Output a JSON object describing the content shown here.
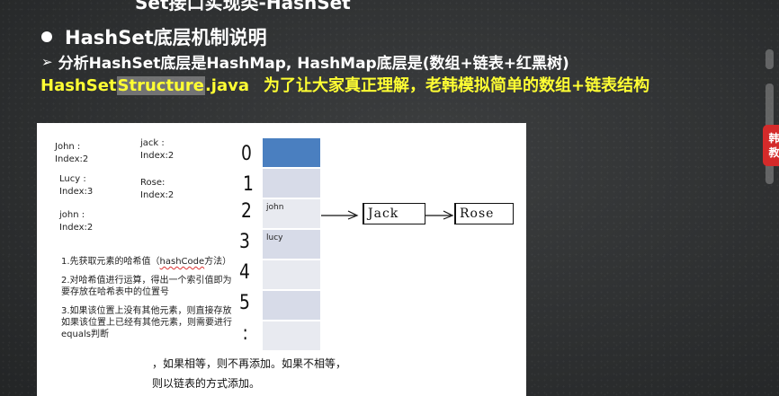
{
  "header": {
    "partial_title": "Set接口实现类-HashSet",
    "bullet_title": "HashSet底层机制说明",
    "sub_title": "分析HashSet底层是HashMap, HashMap底层是(数组+链表+红黑树)",
    "yellow_prefix": "HashSet",
    "yellow_highlight": "Structure",
    "yellow_suffix": ".java",
    "yellow_note": "为了让大家真正理解，老韩模拟简单的数组+链表结构"
  },
  "badge": {
    "line1": "韩",
    "line2": "教"
  },
  "panel": {
    "notes": [
      {
        "text": "John :\nIndex:2"
      },
      {
        "text": "jack :\nIndex:2"
      },
      {
        "text": "Lucy :\nIndex:3"
      },
      {
        "text": "Rose:\nIndex:2"
      },
      {
        "text": "john :\nIndex:2"
      }
    ],
    "steps": [
      {
        "pre": "1.先获取元素的哈希值（",
        "code": "hashCode",
        "post": "方法）"
      },
      {
        "pre": "2.对哈希值进行运算，得出一个索引值即为要存放在哈希表中的位置号",
        "code": "",
        "post": ""
      },
      {
        "pre": "3.如果该位置上没有其他元素，则直接存放\n如果该位置上已经有其他元素，则需要进行equals判断",
        "code": "",
        "post": ""
      }
    ],
    "tail1": "，如果相等，则不再添加。如果不相等，",
    "tail2": "则以链表的方式添加。",
    "indices": [
      "0",
      "1",
      "2",
      "3",
      "4",
      "5",
      ":"
    ],
    "cells": [
      "",
      "",
      "john",
      "lucy",
      "",
      "",
      ""
    ],
    "chain": [
      "Jack",
      "Rose"
    ]
  }
}
